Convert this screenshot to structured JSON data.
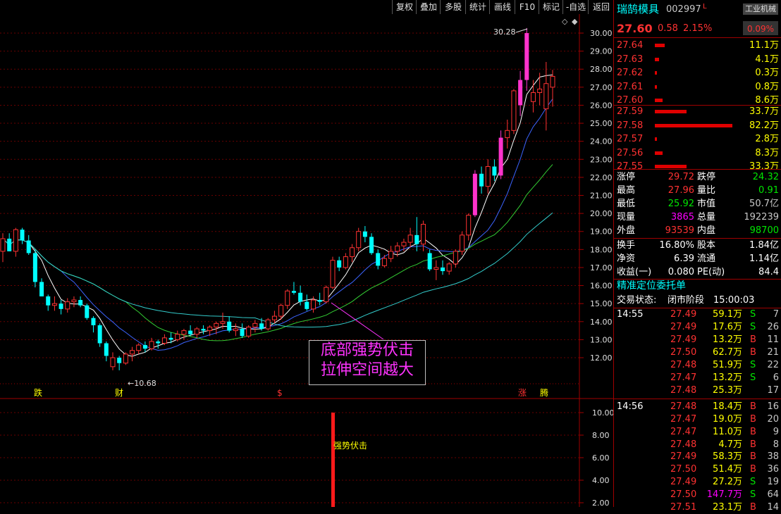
{
  "toolbar": {
    "buttons": [
      "复权",
      "叠加",
      "多股",
      "统计",
      "画线",
      "F10",
      "标记",
      "-自选",
      "返回"
    ]
  },
  "chart": {
    "price_axis": [
      "30.00",
      "29.00",
      "28.00",
      "27.00",
      "26.00",
      "25.00",
      "24.00",
      "23.00",
      "22.00",
      "21.00",
      "20.00",
      "19.00",
      "18.00",
      "17.00",
      "16.00",
      "15.00",
      "14.00",
      "13.00",
      "12.00"
    ],
    "high_label": "30.28",
    "low_label": "10.68",
    "annotation_line1": "底部强势伏击",
    "annotation_line2": "拉伸空间越大",
    "markers": {
      "die": "跌",
      "cai": "财",
      "s": "$",
      "zhang": "涨",
      "teng": "腾"
    },
    "sub_axis": [
      "10.00",
      "8.00",
      "6.00",
      "4.00",
      "2.00"
    ],
    "sub_label": "强势伏击",
    "colors": {
      "up": "#ff3232",
      "down": "#00ffff",
      "limit_up": "#ff33cc",
      "ma5": "#ffffff",
      "ma10": "#3c64ff",
      "ma20": "#33cc33",
      "ma60": "#33cccc"
    }
  },
  "panel": {
    "stock_name": "瑞鹄模具",
    "stock_code": "002997",
    "stock_flag": "L",
    "industry": "工业机械",
    "industry_pct": "0.09%",
    "price": "27.60",
    "change": "0.58",
    "change_pct": "2.15%",
    "asks": [
      {
        "price": "27.64",
        "vol": "11.1万",
        "bar": 0.13
      },
      {
        "price": "27.63",
        "vol": "4.1万",
        "bar": 0.05
      },
      {
        "price": "27.62",
        "vol": "0.3万",
        "bar": 0.02
      },
      {
        "price": "27.61",
        "vol": "0.8万",
        "bar": 0.02
      },
      {
        "price": "27.60",
        "vol": "8.6万",
        "bar": 0.1
      }
    ],
    "bids": [
      {
        "price": "27.59",
        "vol": "33.7万",
        "bar": 0.41
      },
      {
        "price": "27.58",
        "vol": "82.2万",
        "bar": 1.0
      },
      {
        "price": "27.57",
        "vol": "2.8万",
        "bar": 0.03
      },
      {
        "price": "27.56",
        "vol": "8.3万",
        "bar": 0.1
      },
      {
        "price": "27.55",
        "vol": "33.3万",
        "bar": 0.41
      }
    ],
    "stats": [
      {
        "l1": "涨停",
        "v1": "29.72",
        "c1": "red",
        "l2": "跌停",
        "v2": "24.32",
        "c2": "green"
      },
      {
        "l1": "最高",
        "v1": "27.96",
        "c1": "red",
        "l2": "量比",
        "v2": "0.91",
        "c2": "green"
      },
      {
        "l1": "最低",
        "v1": "25.92",
        "c1": "green",
        "l2": "市值",
        "v2": "50.7亿",
        "c2": "grey"
      },
      {
        "l1": "现量",
        "v1": "3865",
        "c1": "magenta",
        "l2": "总量",
        "v2": "192239",
        "c2": "grey"
      },
      {
        "l1": "外盘",
        "v1": "93539",
        "c1": "red",
        "l2": "内盘",
        "v2": "98700",
        "c2": "green"
      }
    ],
    "fund": [
      {
        "l1": "换手",
        "v1": "16.80%",
        "l2": "股本",
        "v2": "1.84亿"
      },
      {
        "l1": "净资",
        "v1": "6.39",
        "l2": "流通",
        "v2": "1.14亿"
      },
      {
        "l1": "收益(一)",
        "v1": "0.080",
        "l2": "PE(动)",
        "v2": "84.4"
      }
    ],
    "precise_label": "精准定位委托单",
    "trade_state_label": "交易状态:",
    "trade_state": "闭市阶段",
    "trade_time": "15:00:03",
    "ticks": [
      {
        "t": "14:55",
        "p": "27.49",
        "v": "59.1万",
        "s": "S",
        "n": "7"
      },
      {
        "t": "",
        "p": "27.49",
        "v": "17.6万",
        "s": "S",
        "n": "26"
      },
      {
        "t": "",
        "p": "27.49",
        "v": "13.2万",
        "s": "B",
        "n": "11"
      },
      {
        "t": "",
        "p": "27.50",
        "v": "62.7万",
        "s": "B",
        "n": "21"
      },
      {
        "t": "",
        "p": "27.48",
        "v": "51.9万",
        "s": "S",
        "n": "22"
      },
      {
        "t": "",
        "p": "27.47",
        "v": "13.2万",
        "s": "S",
        "n": "6"
      },
      {
        "t": "",
        "p": "27.48",
        "v": "25.3万",
        "s": "",
        "n": "17"
      },
      {
        "t": "14:56",
        "p": "27.48",
        "v": "18.4万",
        "s": "B",
        "n": "16"
      },
      {
        "t": "",
        "p": "27.47",
        "v": "19.0万",
        "s": "B",
        "n": "20"
      },
      {
        "t": "",
        "p": "27.47",
        "v": "11.0万",
        "s": "B",
        "n": "9"
      },
      {
        "t": "",
        "p": "27.48",
        "v": "4.7万",
        "s": "B",
        "n": "8"
      },
      {
        "t": "",
        "p": "27.49",
        "v": "58.3万",
        "s": "B",
        "n": "38"
      },
      {
        "t": "",
        "p": "27.50",
        "v": "51.4万",
        "s": "B",
        "n": "36"
      },
      {
        "t": "",
        "p": "27.49",
        "v": "27.2万",
        "s": "S",
        "n": "19"
      },
      {
        "t": "",
        "p": "27.50",
        "v": "147.7万",
        "s": "S",
        "n": "64"
      },
      {
        "t": "",
        "p": "27.51",
        "v": "23.1万",
        "s": "B",
        "n": "14"
      }
    ]
  },
  "chart_data": {
    "type": "candlestick",
    "ylim": [
      11,
      30.7
    ],
    "candles": [
      [
        17.9,
        18.9,
        17.3,
        18.6
      ],
      [
        18.6,
        18.9,
        17.9,
        17.9
      ],
      [
        17.9,
        19.2,
        17.6,
        19.1
      ],
      [
        19.1,
        19.2,
        18.3,
        18.5
      ],
      [
        18.5,
        18.8,
        17.7,
        17.8
      ],
      [
        17.8,
        18.0,
        15.9,
        16.2
      ],
      [
        16.2,
        16.4,
        15.4,
        15.4
      ],
      [
        15.4,
        15.5,
        14.6,
        14.9
      ],
      [
        14.9,
        15.4,
        14.6,
        15.0
      ],
      [
        15.0,
        15.2,
        14.4,
        14.7
      ],
      [
        14.7,
        15.3,
        14.5,
        15.1
      ],
      [
        15.1,
        15.4,
        14.8,
        15.2
      ],
      [
        15.2,
        15.4,
        14.8,
        14.9
      ],
      [
        14.9,
        15.0,
        14.1,
        14.2
      ],
      [
        14.2,
        14.3,
        13.4,
        13.8
      ],
      [
        13.8,
        13.9,
        12.6,
        12.8
      ],
      [
        12.8,
        12.9,
        11.8,
        12.1
      ],
      [
        11.5,
        12.3,
        11.3,
        12.0
      ],
      [
        12.0,
        12.1,
        11.3,
        11.7
      ],
      [
        11.7,
        12.3,
        11.6,
        12.2
      ],
      [
        12.2,
        12.6,
        11.8,
        12.4
      ],
      [
        12.4,
        12.8,
        12.2,
        12.7
      ],
      [
        12.7,
        12.9,
        12.3,
        12.5
      ],
      [
        12.5,
        13.1,
        12.4,
        12.9
      ],
      [
        12.9,
        13.0,
        12.5,
        12.8
      ],
      [
        12.8,
        13.3,
        12.7,
        13.1
      ],
      [
        13.1,
        13.4,
        12.8,
        13.0
      ],
      [
        13.0,
        13.5,
        12.9,
        13.3
      ],
      [
        13.3,
        13.6,
        13.0,
        13.5
      ],
      [
        13.5,
        13.8,
        13.2,
        13.3
      ],
      [
        13.3,
        13.7,
        13.1,
        13.6
      ],
      [
        13.6,
        13.8,
        13.3,
        13.5
      ],
      [
        13.5,
        13.8,
        13.2,
        13.7
      ],
      [
        13.7,
        14.0,
        13.3,
        13.9
      ],
      [
        13.9,
        14.5,
        13.6,
        14.0
      ],
      [
        14.0,
        14.3,
        13.4,
        13.5
      ],
      [
        13.5,
        13.9,
        13.2,
        13.6
      ],
      [
        13.6,
        13.9,
        13.1,
        13.2
      ],
      [
        13.2,
        13.8,
        13.1,
        13.7
      ],
      [
        13.7,
        14.1,
        13.4,
        13.9
      ],
      [
        13.9,
        14.2,
        13.5,
        13.6
      ],
      [
        13.6,
        14.2,
        13.5,
        14.1
      ],
      [
        14.1,
        14.6,
        13.9,
        14.3
      ],
      [
        14.3,
        15.0,
        14.1,
        14.9
      ],
      [
        14.9,
        15.8,
        14.7,
        15.7
      ],
      [
        15.7,
        16.2,
        15.5,
        15.6
      ],
      [
        15.6,
        16.0,
        14.9,
        15.1
      ],
      [
        15.1,
        15.5,
        14.6,
        14.7
      ],
      [
        14.7,
        15.4,
        14.5,
        15.2
      ],
      [
        15.2,
        15.6,
        14.9,
        15.1
      ],
      [
        15.1,
        16.0,
        15.0,
        15.9
      ],
      [
        15.9,
        17.6,
        15.8,
        17.4
      ],
      [
        17.4,
        17.6,
        16.8,
        17.0
      ],
      [
        17.0,
        17.8,
        16.9,
        17.6
      ],
      [
        17.6,
        18.3,
        17.3,
        18.1
      ],
      [
        18.1,
        19.2,
        17.9,
        19.0
      ],
      [
        19.0,
        19.3,
        18.4,
        18.7
      ],
      [
        18.7,
        18.9,
        17.7,
        17.8
      ],
      [
        17.8,
        18.0,
        16.9,
        17.1
      ],
      [
        17.1,
        17.7,
        17.0,
        17.5
      ],
      [
        17.5,
        18.2,
        17.3,
        17.9
      ],
      [
        17.9,
        18.4,
        17.6,
        18.2
      ],
      [
        18.2,
        18.6,
        17.9,
        18.4
      ],
      [
        18.4,
        19.2,
        18.1,
        18.8
      ],
      [
        18.8,
        19.8,
        17.9,
        18.3
      ],
      [
        18.3,
        19.6,
        17.9,
        19.4
      ],
      [
        17.8,
        18.0,
        16.8,
        16.9
      ],
      [
        16.9,
        17.4,
        16.3,
        17.0
      ],
      [
        17.0,
        17.4,
        16.6,
        16.8
      ],
      [
        16.8,
        17.3,
        16.6,
        17.2
      ],
      [
        17.2,
        18.0,
        17.0,
        17.9
      ],
      [
        17.9,
        19.0,
        17.7,
        18.8
      ],
      [
        18.8,
        20.0,
        18.5,
        19.9
      ],
      [
        19.9,
        22.4,
        19.8,
        22.2
      ],
      [
        22.2,
        22.6,
        21.1,
        21.5
      ],
      [
        21.5,
        23.0,
        21.1,
        22.6
      ],
      [
        22.6,
        23.0,
        21.8,
        22.1
      ],
      [
        22.1,
        24.6,
        21.9,
        24.2
      ],
      [
        24.2,
        25.2,
        23.6,
        24.6
      ],
      [
        24.6,
        26.9,
        24.4,
        26.8
      ],
      [
        26.0,
        27.9,
        25.4,
        27.4
      ],
      [
        27.4,
        30.28,
        26.8,
        30.0
      ],
      [
        26.2,
        27.4,
        25.6,
        26.7
      ],
      [
        26.7,
        27.8,
        26.0,
        26.9
      ],
      [
        25.8,
        28.4,
        24.6,
        27.2
      ],
      [
        27.0,
        27.96,
        25.92,
        27.6
      ]
    ],
    "limit_up_days": [
      73,
      77,
      80,
      81
    ],
    "volume_signal": {
      "index": 48,
      "value": 10.0
    }
  }
}
